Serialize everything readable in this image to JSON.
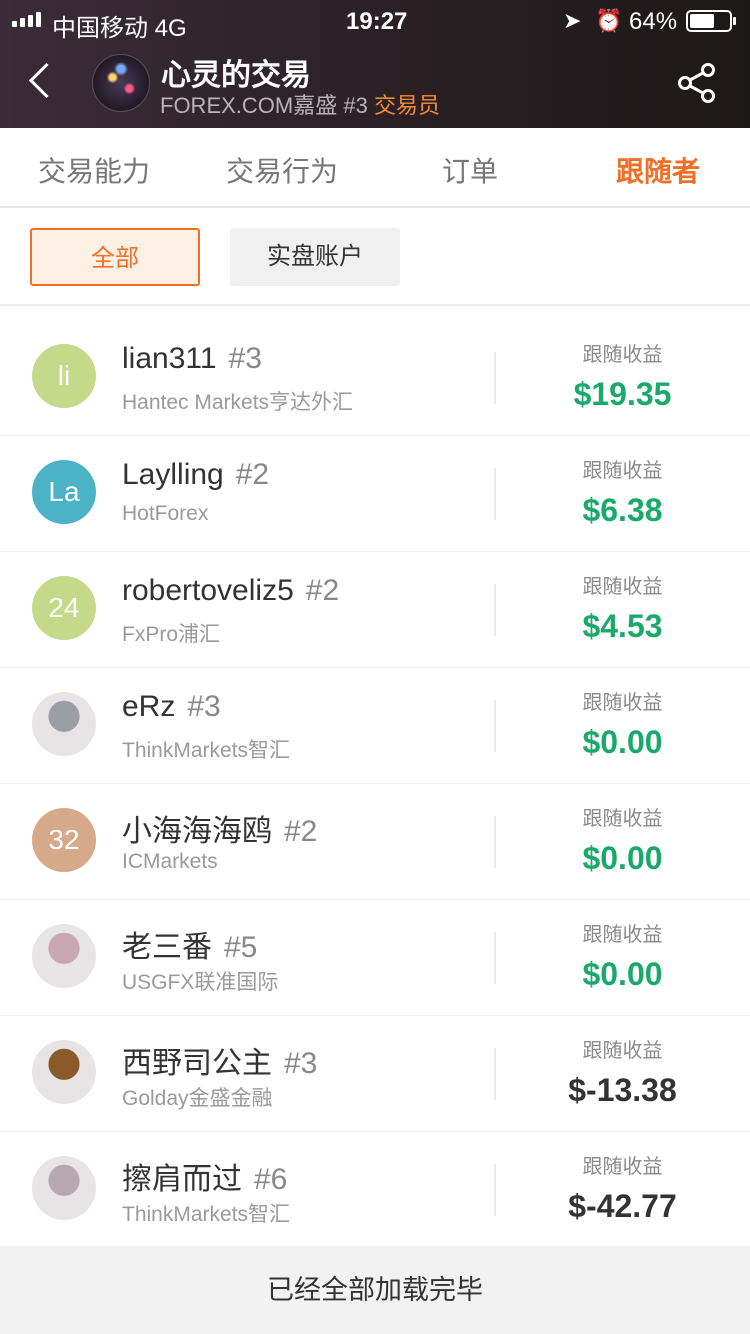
{
  "status_bar": {
    "carrier": "中国移动 4G",
    "time": "19:27",
    "location_icon": "location-arrow-icon",
    "alarm_icon": "alarm-clock-icon",
    "battery_text": "64%",
    "battery_level": 0.64
  },
  "header": {
    "back_icon": "back-chevron-icon",
    "trader_name": "心灵的交易",
    "broker": "FOREX.COM嘉盛",
    "rank": "#3",
    "role": "交易员",
    "share_icon": "share-icon"
  },
  "tabs": [
    {
      "label": "交易能力",
      "active": false
    },
    {
      "label": "交易行为",
      "active": false
    },
    {
      "label": "订单",
      "active": false
    },
    {
      "label": "跟随者",
      "active": true
    }
  ],
  "filters": {
    "all": "全部",
    "real": "实盘账户"
  },
  "colors": {
    "accent": "#f26f26",
    "profit": "#19a96b",
    "loss": "#333333"
  },
  "followers": [
    {
      "name": "lian311",
      "rank": "#3",
      "broker": "Hantec Markets亨达外汇",
      "earn_label": "跟随收益",
      "earn": "$19.35",
      "avatar_text": "li",
      "avatar_color": "#c5d98a",
      "positive": true
    },
    {
      "name": "Laylling",
      "rank": "#2",
      "broker": "HotForex",
      "earn_label": "跟随收益",
      "earn": "$6.38",
      "avatar_text": "La",
      "avatar_color": "#4cb2c6",
      "positive": true
    },
    {
      "name": "robertoveliz5",
      "rank": "#2",
      "broker": "FxPro浦汇",
      "earn_label": "跟随收益",
      "earn": "$4.53",
      "avatar_text": "24",
      "avatar_color": "#c5d98a",
      "positive": true
    },
    {
      "name": "eRz",
      "rank": "#3",
      "broker": "ThinkMarkets智汇",
      "earn_label": "跟随收益",
      "earn": "$0.00",
      "avatar_text": "",
      "avatar_color": "#9a9fa6",
      "positive": true
    },
    {
      "name": "小海海海鸥",
      "rank": "#2",
      "broker": "ICMarkets",
      "earn_label": "跟随收益",
      "earn": "$0.00",
      "avatar_text": "32",
      "avatar_color": "#d6a98a",
      "positive": true
    },
    {
      "name": "老三番",
      "rank": "#5",
      "broker": "USGFX联准国际",
      "earn_label": "跟随收益",
      "earn": "$0.00",
      "avatar_text": "",
      "avatar_color": "#c9a7b2",
      "positive": true
    },
    {
      "name": "西野司公主",
      "rank": "#3",
      "broker": "Golday金盛金融",
      "earn_label": "跟随收益",
      "earn": "$-13.38",
      "avatar_text": "",
      "avatar_color": "#8a5a2a",
      "positive": false
    },
    {
      "name": "擦肩而过",
      "rank": "#6",
      "broker": "ThinkMarkets智汇",
      "earn_label": "跟随收益",
      "earn": "$-42.77",
      "avatar_text": "",
      "avatar_color": "#b7a7b0",
      "positive": false
    }
  ],
  "footer": {
    "text": "已经全部加载完毕"
  }
}
